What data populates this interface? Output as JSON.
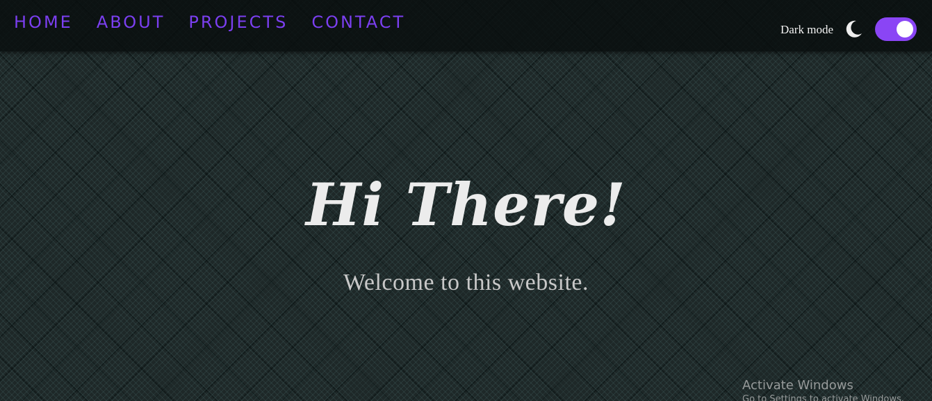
{
  "navbar": {
    "links": [
      {
        "label": "HOME"
      },
      {
        "label": "ABOUT"
      },
      {
        "label": "PROJECTS"
      },
      {
        "label": "CONTACT"
      }
    ]
  },
  "theme_toggle": {
    "label": "Dark mode",
    "icon": "moon-icon",
    "enabled": true
  },
  "hero": {
    "title": "Hi There!",
    "subtitle": "Welcome to this website."
  },
  "os_watermark": {
    "title": "Activate Windows",
    "subtitle": "Go to Settings to activate Windows."
  },
  "colors": {
    "accent": "#7b3ff0",
    "toggle": "#8a45f5",
    "background": "#1e2828",
    "text": "#ececec"
  }
}
